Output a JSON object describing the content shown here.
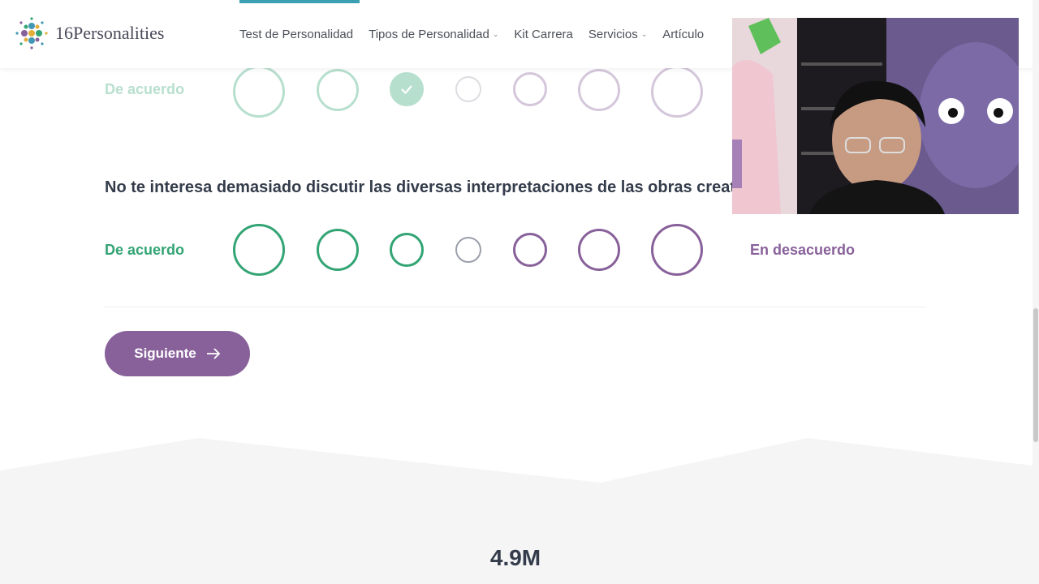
{
  "brand": {
    "name": "16Personalities"
  },
  "nav": {
    "items": [
      {
        "label": "Test de Personalidad",
        "has_dropdown": false,
        "active": true
      },
      {
        "label": "Tipos de Personalidad",
        "has_dropdown": true
      },
      {
        "label": "Kit Carrera",
        "has_dropdown": false
      },
      {
        "label": "Servicios",
        "has_dropdown": true
      },
      {
        "label": "Artículo",
        "has_dropdown": false
      }
    ]
  },
  "previous_question": {
    "agree_label": "De acuerdo",
    "selected_index": 2
  },
  "current_question": {
    "text": "No te interesa demasiado discutir las diversas interpretaciones de las obras creativas.",
    "agree_label": "De acuerdo",
    "disagree_label": "En desacuerdo"
  },
  "next_button": {
    "label": "Siguiente"
  },
  "stats": {
    "value": "4.9M"
  },
  "colors": {
    "agree": "#33a474",
    "neutral": "#9b9faa",
    "disagree": "#88619a",
    "accent_bar": "#3a9fb0"
  }
}
